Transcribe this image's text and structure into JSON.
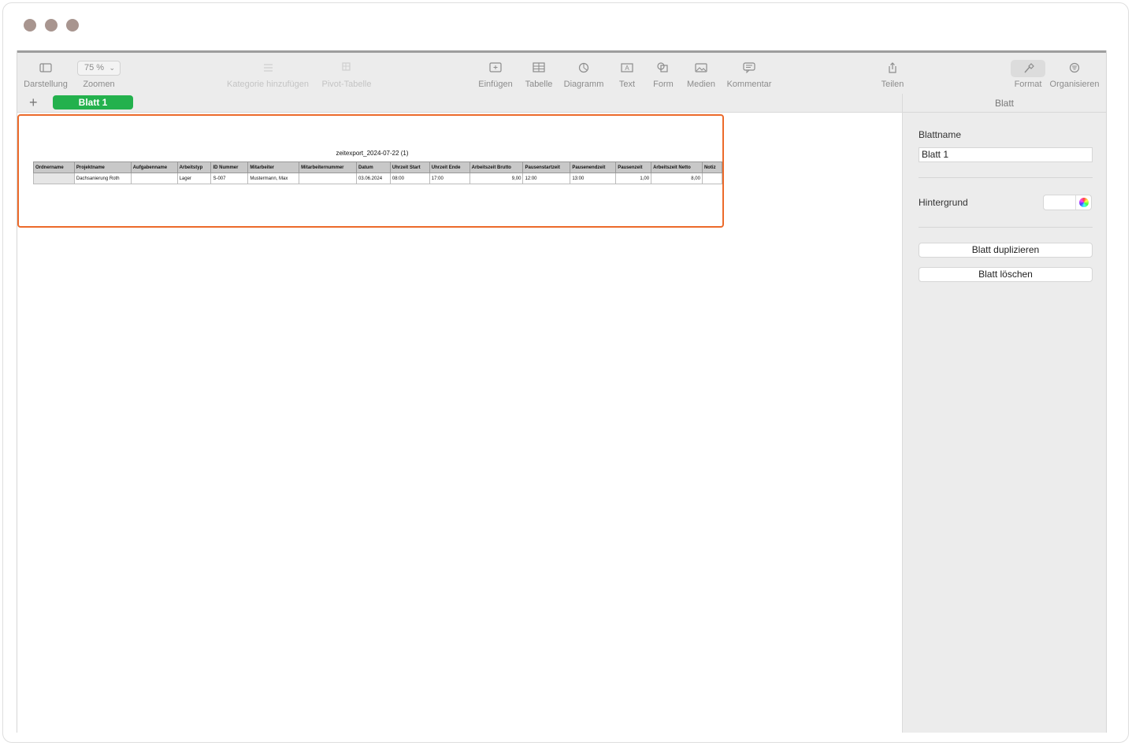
{
  "toolbar": {
    "items": [
      {
        "label": "Darstellung",
        "icon": "sidebar-icon"
      },
      {
        "label": "Zoomen",
        "value": "75 %"
      },
      {
        "label": "Kategorie hinzufügen",
        "icon": "category-icon",
        "disabled": true
      },
      {
        "label": "Pivot-Tabelle",
        "icon": "pivot-table-icon",
        "disabled": true
      },
      {
        "label": "Einfügen",
        "icon": "insert-icon"
      },
      {
        "label": "Tabelle",
        "icon": "table-icon"
      },
      {
        "label": "Diagramm",
        "icon": "chart-icon"
      },
      {
        "label": "Text",
        "icon": "text-icon"
      },
      {
        "label": "Form",
        "icon": "shape-icon"
      },
      {
        "label": "Medien",
        "icon": "media-icon"
      },
      {
        "label": "Kommentar",
        "icon": "comment-icon"
      },
      {
        "label": "Teilen",
        "icon": "share-icon"
      },
      {
        "label": "Format",
        "icon": "format-brush-icon"
      },
      {
        "label": "Organisieren",
        "icon": "organize-icon"
      }
    ]
  },
  "sheets": {
    "add_label": "+",
    "active": "Blatt 1"
  },
  "panel": {
    "title": "Blatt",
    "name_label": "Blattname",
    "name_value": "Blatt 1",
    "background_label": "Hintergrund",
    "duplicate_label": "Blatt duplizieren",
    "delete_label": "Blatt löschen"
  },
  "document": {
    "title": "zeitexport_2024-07-22 (1)",
    "columns": [
      "Ordnername",
      "Projektname",
      "Aufgabenname",
      "Arbeitstyp",
      "ID Nummer",
      "Mitarbeiter",
      "Mitarbeiternummer",
      "Datum",
      "Uhrzeit Start",
      "Uhrzeit Ende",
      "Arbeitszeit Brutto",
      "Pausenstartzeit",
      "Pausenendzeit",
      "Pausenzeit",
      "Arbeitszeit Netto",
      "Notiz"
    ],
    "rows": [
      [
        "",
        "Dachsanierung Roth",
        "",
        "Lager",
        "S-007",
        "Mustermann, Max",
        "",
        "03.06.2024",
        "08:00",
        "17:00",
        "9,00",
        "12:00",
        "13:00",
        "1,00",
        "8,00",
        ""
      ]
    ]
  },
  "colors": {
    "selection": "#ec6a2a",
    "sheet_tab": "#23b14d",
    "traffic": "#a8958f"
  }
}
